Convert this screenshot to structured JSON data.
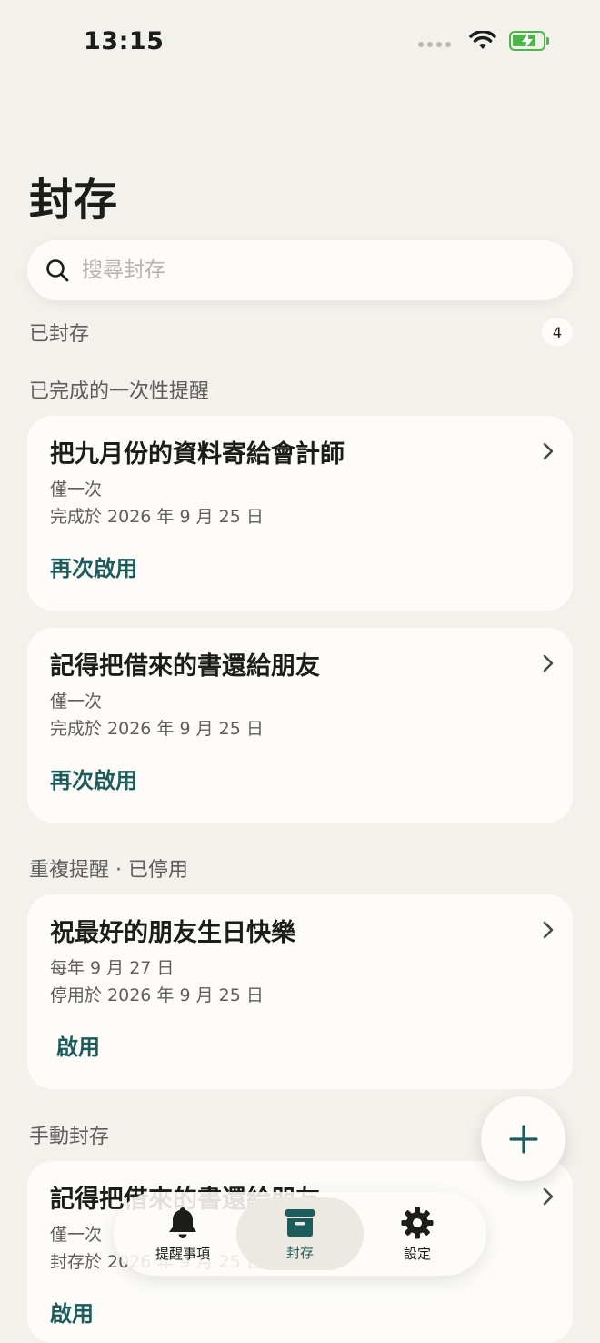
{
  "status_bar": {
    "time": "13:15",
    "battery_level": 0.8
  },
  "header": {
    "title": "封存"
  },
  "search": {
    "placeholder": "搜尋封存",
    "value": ""
  },
  "archived": {
    "label": "已封存",
    "count": "4"
  },
  "sections": [
    {
      "header": "已完成的一次性提醒",
      "cards": [
        {
          "title": "把九月份的資料寄給會計師",
          "frequency": "僅一次",
          "status": "完成於 2026 年 9 月 25 日",
          "action": "再次啟用"
        },
        {
          "title": "記得把借來的書還給朋友",
          "frequency": "僅一次",
          "status": "完成於 2026 年 9 月 25 日",
          "action": "再次啟用"
        }
      ]
    },
    {
      "header": "重複提醒 · 已停用",
      "cards": [
        {
          "title": "祝最好的朋友生日快樂",
          "frequency": "每年 9 月 27 日",
          "status": "停用於 2026 年 9 月 25 日",
          "action": "啟用"
        }
      ]
    },
    {
      "header": "手動封存",
      "cards": [
        {
          "title": "記得把借來的書還給朋友",
          "frequency": "僅一次",
          "status": "封存於 2026 年 9 月 25 日",
          "action": "啟用"
        }
      ]
    }
  ],
  "tab_bar": {
    "tabs": [
      {
        "label": "提醒事項",
        "icon": "bell-icon"
      },
      {
        "label": "封存",
        "icon": "archive-box-icon",
        "active": true
      },
      {
        "label": "設定",
        "icon": "gear-icon"
      }
    ]
  },
  "fab": {
    "icon": "plus-icon"
  },
  "colors": {
    "accent": "#1d5c5c",
    "background": "#f3f1ec",
    "card": "#fdfcf8",
    "battery": "#4cb648"
  }
}
